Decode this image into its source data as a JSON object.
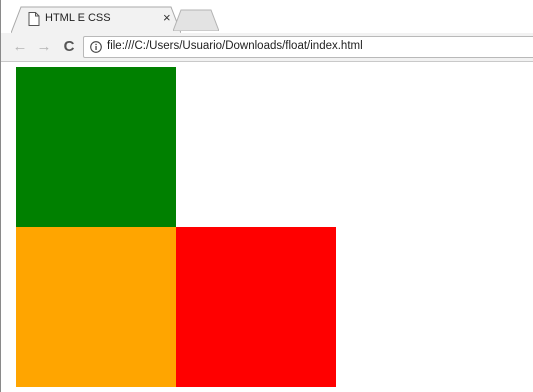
{
  "tab": {
    "title": "HTML E CSS",
    "close_glyph": "×",
    "icon": "document-icon"
  },
  "toolbar": {
    "back_glyph": "←",
    "forward_glyph": "→",
    "reload_glyph": "C",
    "url": "file:///C:/Users/Usuario/Downloads/float/index.html",
    "info_icon": "info-icon"
  },
  "page": {
    "boxes": [
      {
        "name": "green",
        "color": "#008000"
      },
      {
        "name": "orange",
        "color": "#ffa500"
      },
      {
        "name": "red",
        "color": "#ff0000"
      }
    ]
  }
}
